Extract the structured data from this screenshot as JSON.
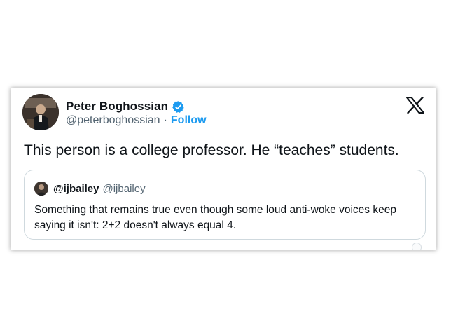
{
  "tweet": {
    "author": {
      "name": "Peter Boghossian",
      "handle": "@peterboghossian",
      "separator": "·",
      "follow_label": "Follow",
      "verified": true,
      "verified_color": "#1d9bf0"
    },
    "platform_icon": "x-logo-icon",
    "text": "This person is a college professor. He “teaches” students.",
    "quoted": {
      "name": "@ijbailey",
      "handle": "@ijbailey",
      "text": "Something that remains true even though some loud anti-woke voices keep saying it isn't: 2+2 doesn't always equal 4."
    }
  },
  "colors": {
    "text": "#0f1419",
    "secondary": "#536471",
    "accent": "#1d9bf0",
    "border": "#cfd9de"
  }
}
